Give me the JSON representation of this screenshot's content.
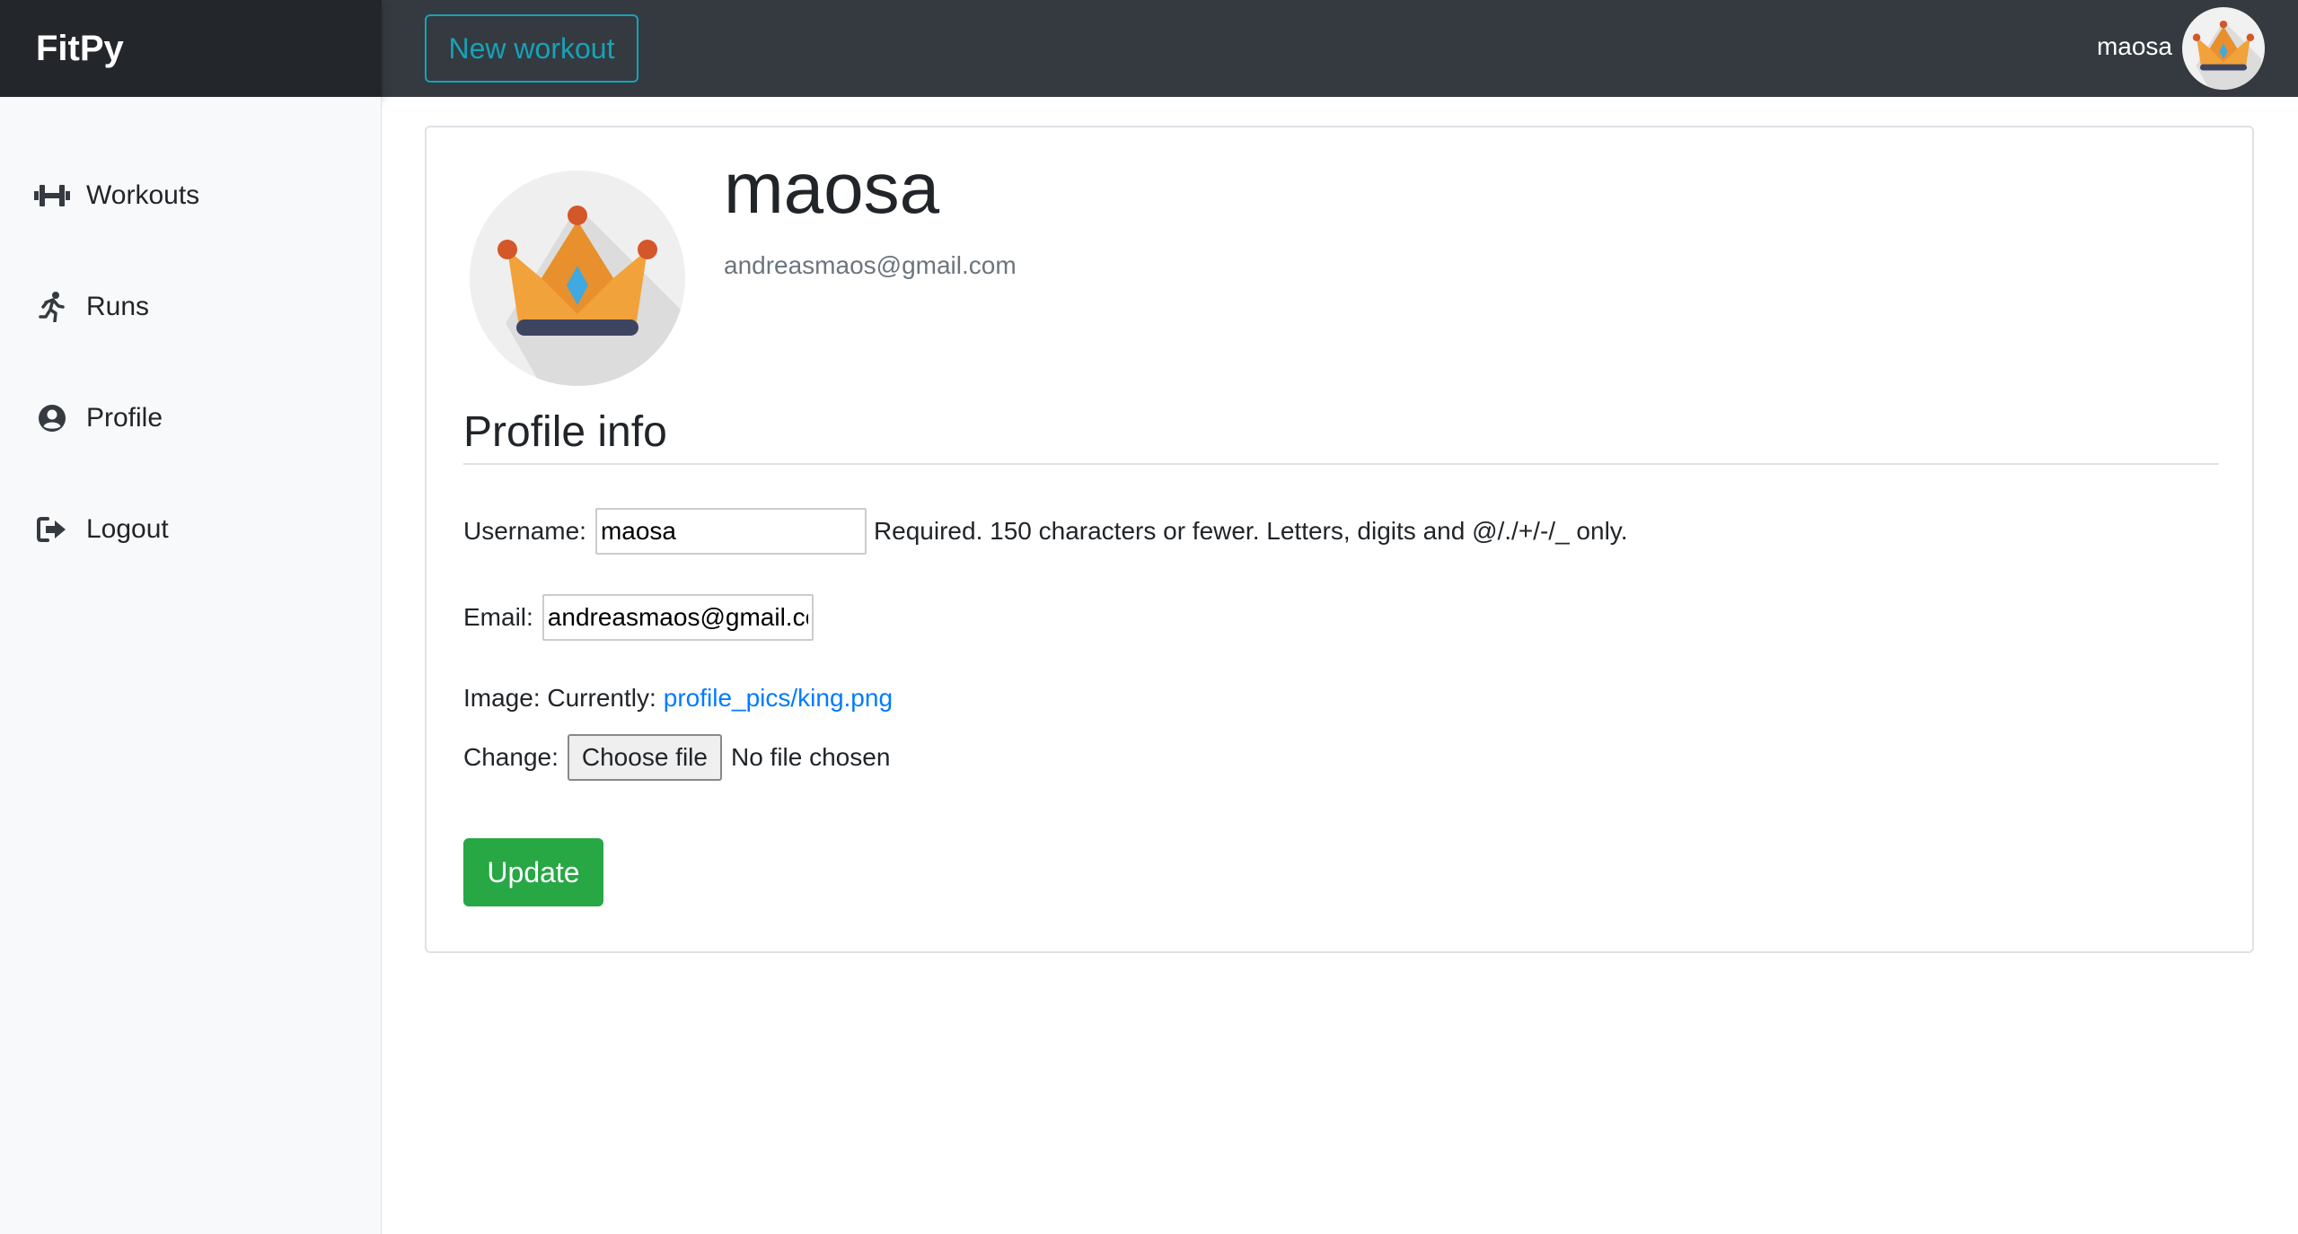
{
  "brand": {
    "name": "FitPy"
  },
  "topbar": {
    "new_workout_label": "New workout",
    "username": "maosa"
  },
  "sidebar": {
    "items": [
      {
        "label": "Workouts",
        "icon": "dumbbell-icon"
      },
      {
        "label": "Runs",
        "icon": "running-icon"
      },
      {
        "label": "Profile",
        "icon": "user-circle-icon"
      },
      {
        "label": "Logout",
        "icon": "sign-out-icon"
      }
    ]
  },
  "profile": {
    "username": "maosa",
    "email": "andreasmaos@gmail.com",
    "avatar": "crown-icon"
  },
  "form": {
    "legend": "Profile info",
    "username_label": "Username:",
    "username_value": "maosa",
    "username_help": "Required. 150 characters or fewer. Letters, digits and @/./+/-/_ only.",
    "email_label": "Email:",
    "email_value": "andreasmaos@gmail.com",
    "image_label": "Image: Currently:",
    "image_current": "profile_pics/king.png",
    "change_label": "Change:",
    "choose_file_label": "Choose file",
    "file_status": "No file chosen",
    "update_label": "Update"
  },
  "colors": {
    "topbar": "#343a40",
    "brand_bg": "#23272b",
    "accent_outline": "#17a2b8",
    "success": "#28a745",
    "link": "#007bff"
  }
}
